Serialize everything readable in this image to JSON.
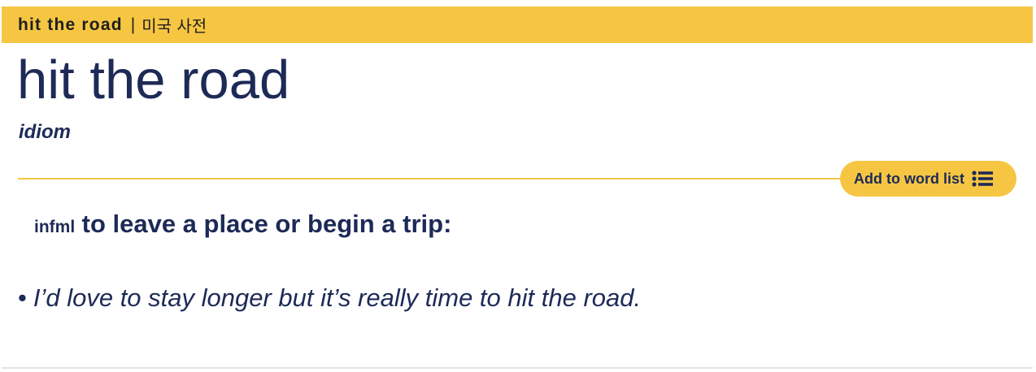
{
  "header": {
    "headword": "hit the road",
    "separator": "|",
    "dictionary": "미국 사전"
  },
  "entry": {
    "headword": "hit the road",
    "pos": "idiom"
  },
  "word_list_button": {
    "label": "Add to word list",
    "icon": "list-icon"
  },
  "sense": {
    "usage": "infml",
    "definition": "to leave a place or begin a trip:"
  },
  "example": {
    "bullet": "•",
    "text": "I’d love to stay longer but it’s really time to hit the road."
  },
  "colors": {
    "accent": "#f6c643",
    "text": "#1d2a57"
  }
}
